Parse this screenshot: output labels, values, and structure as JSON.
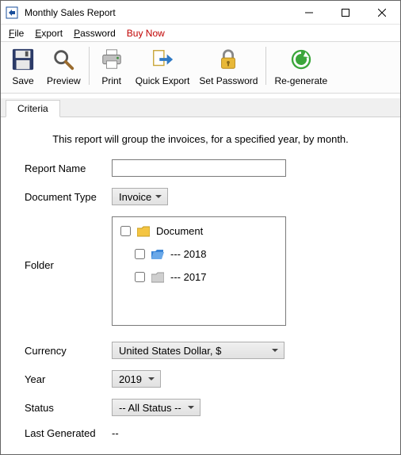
{
  "window": {
    "title": "Monthly Sales Report"
  },
  "menu": {
    "file": "File",
    "export": "Export",
    "password": "Password",
    "buynow": "Buy Now"
  },
  "toolbar": {
    "save": "Save",
    "preview": "Preview",
    "print": "Print",
    "quick_export": "Quick Export",
    "set_password": "Set Password",
    "regenerate": "Re-generate"
  },
  "tabs": {
    "criteria": "Criteria"
  },
  "criteria": {
    "description": "This report will group the invoices, for a specified year, by month.",
    "labels": {
      "report_name": "Report Name",
      "document_type": "Document Type",
      "folder": "Folder",
      "currency": "Currency",
      "year": "Year",
      "status": "Status",
      "last_generated": "Last Generated"
    },
    "values": {
      "report_name": "",
      "document_type": "Invoice",
      "currency": "United States Dollar, $",
      "year": "2019",
      "status": "-- All Status --",
      "last_generated": "--"
    },
    "folder_tree": [
      {
        "label": "Document",
        "indent": 0,
        "color": "yellow"
      },
      {
        "label": "--- 2018",
        "indent": 1,
        "color": "blue"
      },
      {
        "label": "--- 2017",
        "indent": 1,
        "color": "grey"
      }
    ]
  }
}
